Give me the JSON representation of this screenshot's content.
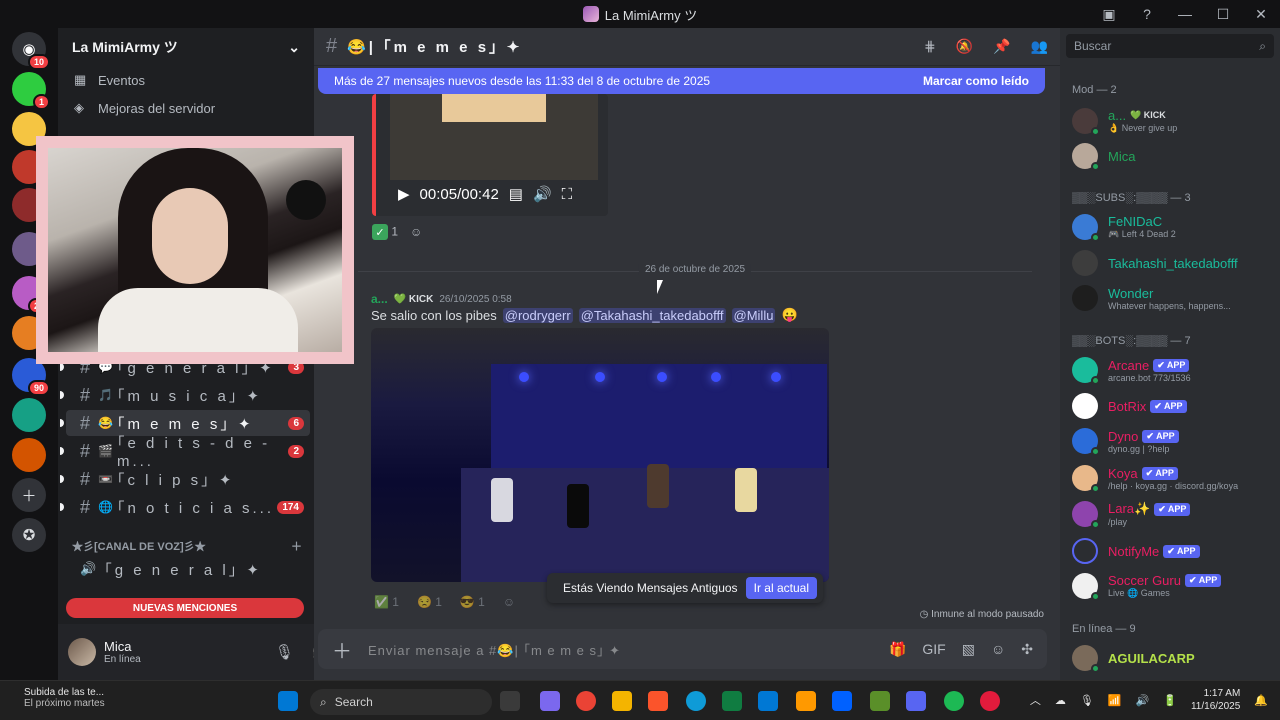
{
  "window": {
    "title": "La MimiArmy ツ"
  },
  "server": {
    "name": "La MimiArmy ツ"
  },
  "sidebar_links": {
    "events": "Eventos",
    "boosts": "Mejoras del servidor"
  },
  "rail_badges": {
    "first": "10",
    "second": "1",
    "third": "24",
    "fourth": "90"
  },
  "channels": [
    {
      "emoji": "💬",
      "name": "｢g e n e r a l｣ ✦",
      "count": "3"
    },
    {
      "emoji": "🎵",
      "name": "｢m u s i c a｣ ✦",
      "count": ""
    },
    {
      "emoji": "😂",
      "name": "｢m e m e s｣ ✦",
      "count": "6"
    },
    {
      "emoji": "🎬",
      "name": "｢e d i t s - d e - m...",
      "count": "2"
    },
    {
      "emoji": "📼",
      "name": "｢c l i p s｣ ✦",
      "count": ""
    },
    {
      "emoji": "🌐",
      "name": "｢n o t i c i a s...",
      "count": "174"
    }
  ],
  "voice_category": "★彡[CANAL DE VOZ]彡★",
  "voice_channel": "｢g e n e r a l｣ ✦",
  "new_mentions": "NUEVAS MENCIONES",
  "user": {
    "name": "Mica",
    "status": "En línea"
  },
  "header": {
    "channel": "😂| ｢m e m e s｣ ✦"
  },
  "newbar": {
    "text": "Más de 27 mensajes nuevos desde las 11:33 del 8 de octubre de 2025",
    "mark": "Marcar como leído"
  },
  "video": {
    "time": "00:05/00:42"
  },
  "reaction": {
    "count": "1"
  },
  "date_divider": "26 de octubre de 2025",
  "message": {
    "author": "a...",
    "tag": "KICK",
    "timestamp": "26/10/2025 0:58",
    "text": "Se salio con los pibes",
    "mentions": [
      "@rodrygerr",
      "@Takahashi_takedabofff",
      "@Millu"
    ]
  },
  "old_messages": {
    "text": "Estás Viendo Mensajes Antiguos",
    "jump": "Ir al actual"
  },
  "immune": "Inmune al modo pausado",
  "composer": {
    "placeholder": "Enviar mensaje a #😂| ｢m e m e s｣ ✦"
  },
  "search": {
    "placeholder": "Buscar"
  },
  "member_groups": {
    "mod": "Mod — 2",
    "subs": "▒▒░SUBS░:▒▒▒▒ — 3",
    "bots": "▒▒░BOTS░:▒▒▒▒ — 7",
    "online": "En línea — 9"
  },
  "members": [
    {
      "name": "a...",
      "tag": "KICK",
      "sub": "👌 Never give up",
      "color": "#23a55a"
    },
    {
      "name": "Mica",
      "tag": "",
      "sub": "",
      "color": "#23a55a"
    },
    {
      "name": "FeNIDaC",
      "tag": "",
      "sub": "🎮 Left 4 Dead 2",
      "color": "#1abc9c"
    },
    {
      "name": "Takahashi_takedabofff",
      "tag": "",
      "sub": "",
      "color": "#1abc9c"
    },
    {
      "name": "Wonder",
      "tag": "",
      "sub": "Whatever happens, happens...",
      "color": "#1abc9c"
    },
    {
      "name": "Arcane",
      "tag": "✔ APP",
      "sub": "arcane.bot 773/1536",
      "color": "#e91e63"
    },
    {
      "name": "BotRix",
      "tag": "✔ APP",
      "sub": "",
      "color": "#e91e63"
    },
    {
      "name": "Dyno",
      "tag": "✔ APP",
      "sub": "dyno.gg | ?help",
      "color": "#e91e63"
    },
    {
      "name": "Koya",
      "tag": "✔ APP",
      "sub": "/help · koya.gg · discord.gg/koya",
      "color": "#e91e63"
    },
    {
      "name": "Lara✨",
      "tag": "✔ APP",
      "sub": "/play",
      "color": "#e91e63"
    },
    {
      "name": "NotifyMe",
      "tag": "✔ APP",
      "sub": "",
      "color": "#e91e63"
    },
    {
      "name": "Soccer Guru",
      "tag": "✔ APP",
      "sub": "Live 🌐 Games",
      "color": "#e91e63"
    },
    {
      "name": "AGUILACARP",
      "tag": "",
      "sub": "",
      "color": "#b4e04a"
    }
  ],
  "taskbar": {
    "weather": "Subida de las te...",
    "weather_sub": "El próximo martes",
    "search": "Search",
    "time": "1:17 AM",
    "date": "11/16/2025"
  },
  "colors": {
    "accent": "#5865f2",
    "danger": "#da373c",
    "online": "#23a55a"
  }
}
